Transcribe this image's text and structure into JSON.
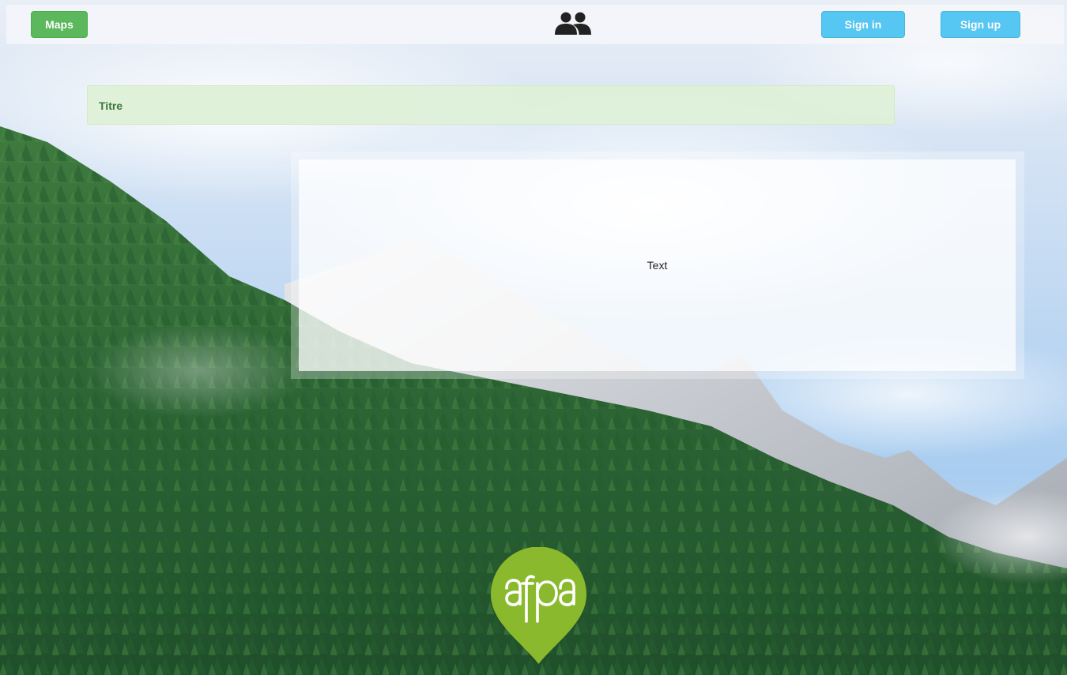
{
  "navbar": {
    "maps_label": "Maps",
    "users_icon": "users-icon",
    "signin_label": "Sign in",
    "signup_label": "Sign up"
  },
  "title_box": {
    "label": "Titre"
  },
  "content_panel": {
    "text": "Text"
  },
  "logo": {
    "text": "afpa",
    "color": "#8ab92d"
  },
  "colors": {
    "maps_button": "#5cb85c",
    "auth_buttons": "#56c6f2",
    "title_bg": "#dff0d8",
    "title_text": "#3c763d"
  }
}
